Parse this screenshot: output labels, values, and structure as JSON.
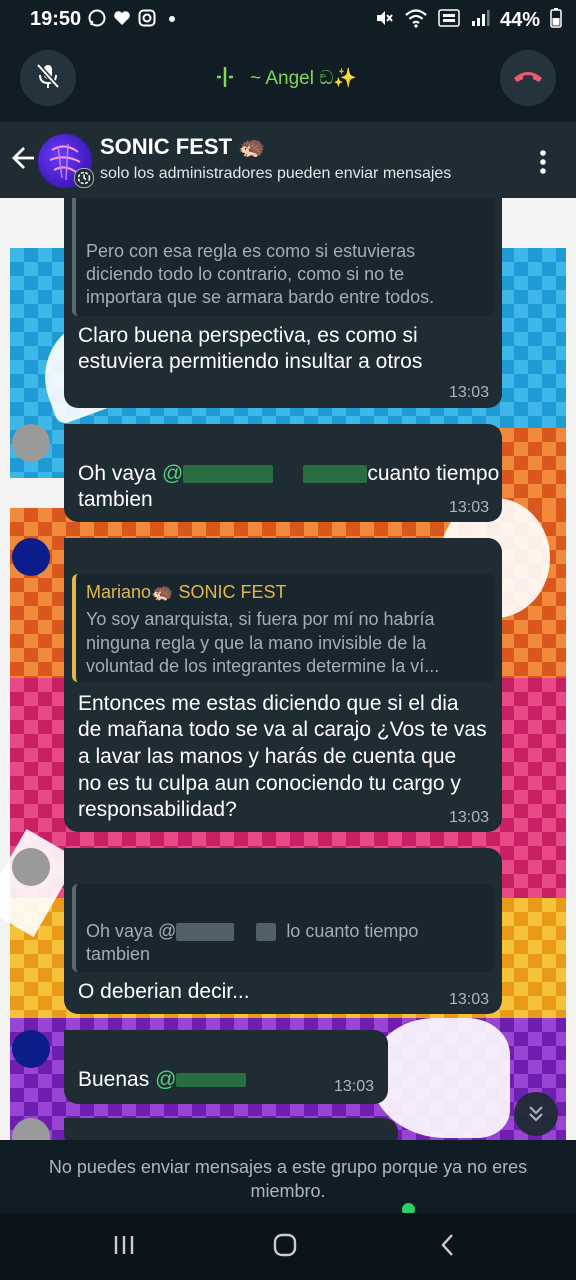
{
  "status_bar": {
    "time": "19:50",
    "battery": "44%"
  },
  "call": {
    "name": "~ Angel ඞ✨"
  },
  "header": {
    "title": "SONIC FEST 🦔",
    "subtitle": "solo los administradores pueden enviar mensajes"
  },
  "messages": [
    {
      "quote_text": "Pero con esa regla es como si estuvieras diciendo todo lo contrario, como si no te importara que se armara bardo entre todos.",
      "quote_lines": [
        "Pero con esa regla es como si estuvieras",
        "diciendo todo lo contrario, como si no te",
        "importara que se armara bardo entre todos."
      ],
      "text_lines": [
        "Claro buena perspectiva, es como si",
        "estuviera permitiendo insultar a otros"
      ],
      "time": "13:03"
    },
    {
      "text_prefix": "Oh vaya ",
      "mention": "@",
      "text_after": "cuanto tiempo",
      "text_line2": "tambien",
      "time": "13:03"
    },
    {
      "quote_author": "Mariano🦔 SONIC FEST",
      "quote_lines": [
        "Yo soy anarquista, si fuera por mí no habría",
        "ninguna regla y que la mano invisible de la",
        "voluntad de los integrantes determine la ví..."
      ],
      "text_lines": [
        "Entonces me estas diciendo que si el dia",
        "de mañana todo se va al carajo ¿Vos te vas",
        "a lavar las manos y harás de cuenta que",
        "no es tu culpa aun conociendo tu cargo y",
        "responsabilidad?"
      ],
      "time": "13:03"
    },
    {
      "quote_prefix": "Oh vaya @",
      "quote_after": "lo cuanto tiempo",
      "quote_line2": "tambien",
      "text": "O deberian decir...",
      "time": "13:03"
    },
    {
      "text": "Buenas ",
      "mention": "@",
      "time": "13:03"
    }
  ],
  "footer": {
    "text_line1": "No puedes enviar mensajes a este grupo porque ya no eres",
    "text_line2": "miembro."
  },
  "colors": {
    "bubble": "#1f2c34",
    "mention": "#4bd37a",
    "quote_author": "#e0b94a",
    "end_call": "#f15c6d"
  }
}
